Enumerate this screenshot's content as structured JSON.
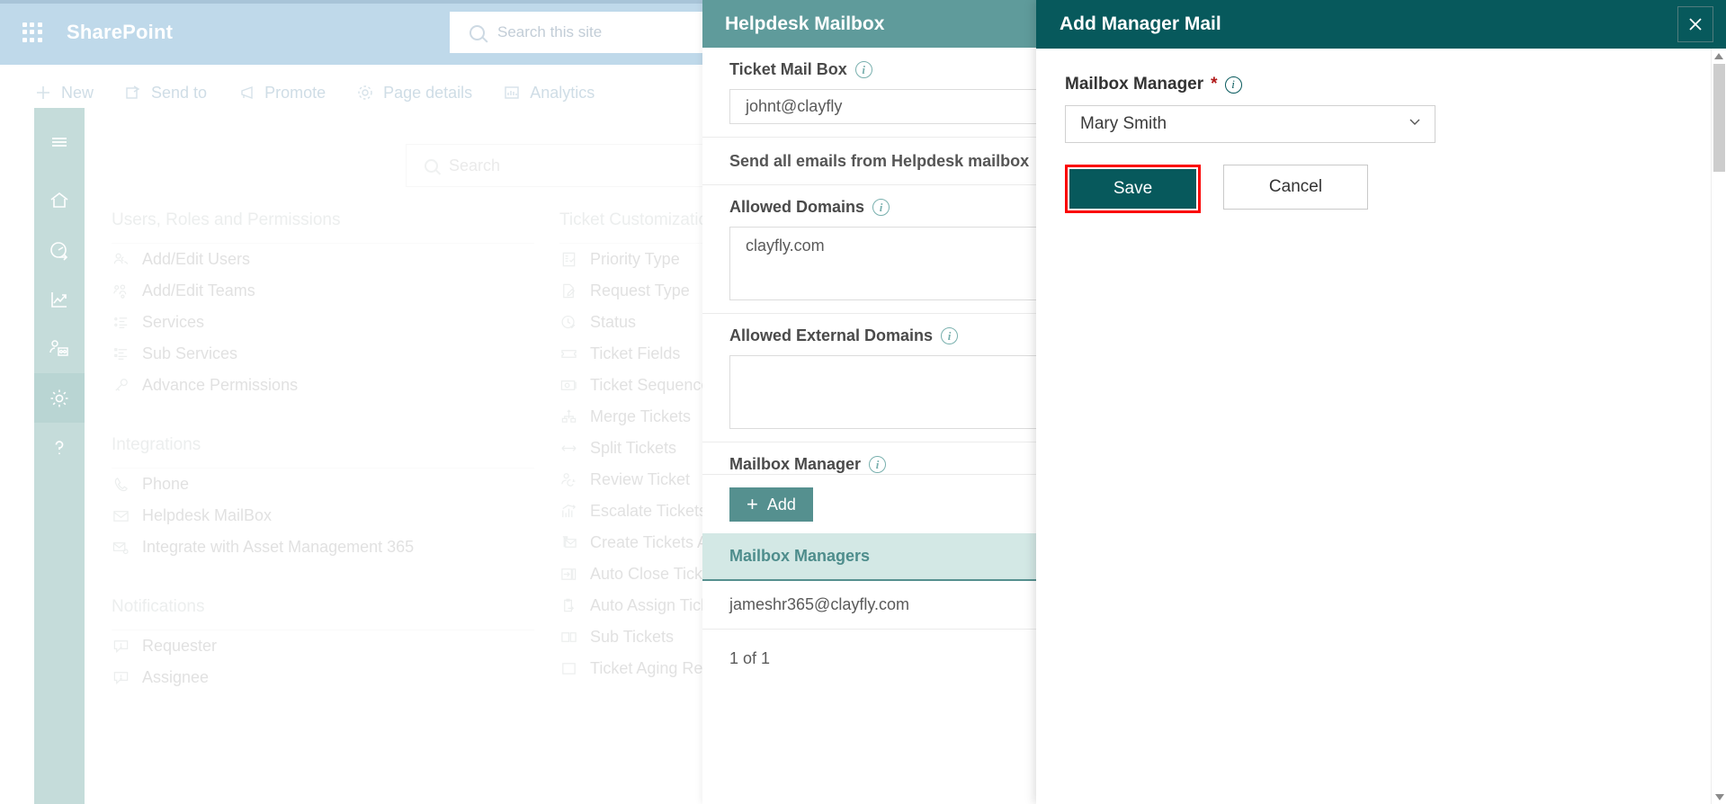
{
  "sharepoint": {
    "brand": "SharePoint",
    "waffle_icon": "app-launcher-icon",
    "search_placeholder": "Search this site",
    "search_icon": "search-icon",
    "commands": [
      {
        "label": "New",
        "icon": "plus-icon"
      },
      {
        "label": "Send to",
        "icon": "send-to-icon"
      },
      {
        "label": "Promote",
        "icon": "megaphone-icon"
      },
      {
        "label": "Page details",
        "icon": "gear-icon"
      },
      {
        "label": "Analytics",
        "icon": "analytics-icon"
      }
    ]
  },
  "left_rail": {
    "items": [
      {
        "name": "hamburger-icon",
        "active": false
      },
      {
        "name": "home-icon",
        "active": false
      },
      {
        "name": "dashboard-icon",
        "active": false
      },
      {
        "name": "reports-icon",
        "active": false
      },
      {
        "name": "agents-icon",
        "active": false
      },
      {
        "name": "settings-icon",
        "active": true
      },
      {
        "name": "help-icon",
        "active": false
      }
    ]
  },
  "settings_page": {
    "search_placeholder": "Search",
    "groups": [
      {
        "title": "Users, Roles and Permissions",
        "items": [
          {
            "label": "Add/Edit Users",
            "icon": "users-icon"
          },
          {
            "label": "Add/Edit Teams",
            "icon": "teams-icon"
          },
          {
            "label": "Services",
            "icon": "list-icon"
          },
          {
            "label": "Sub Services",
            "icon": "sub-list-icon"
          },
          {
            "label": "Advance Permissions",
            "icon": "key-icon"
          }
        ]
      },
      {
        "title": "Integrations",
        "items": [
          {
            "label": "Phone",
            "icon": "phone-icon"
          },
          {
            "label": "Helpdesk MailBox",
            "icon": "envelope-icon"
          },
          {
            "label": "Integrate with Asset Management 365",
            "icon": "envelope-gear-icon"
          }
        ]
      },
      {
        "title": "Notifications",
        "items": [
          {
            "label": "Requester",
            "icon": "comment-icon"
          },
          {
            "label": "Assignee",
            "icon": "comment-icon"
          }
        ]
      }
    ],
    "groups2": [
      {
        "title": "Ticket Customization",
        "items": [
          {
            "label": "Priority Type",
            "icon": "priority-icon"
          },
          {
            "label": "Request Type",
            "icon": "request-icon"
          },
          {
            "label": "Status",
            "icon": "clock-icon"
          },
          {
            "label": "Ticket Fields",
            "icon": "ticket-icon"
          },
          {
            "label": "Ticket Sequence",
            "icon": "sequence-icon"
          },
          {
            "label": "Merge Tickets",
            "icon": "merge-icon"
          },
          {
            "label": "Split Tickets",
            "icon": "split-icon"
          },
          {
            "label": "Review Ticket",
            "icon": "review-icon"
          },
          {
            "label": "Escalate Tickets",
            "icon": "escalate-icon"
          },
          {
            "label": "Create Tickets Automatically",
            "icon": "create-auto-icon"
          },
          {
            "label": "Auto Close Tickets",
            "icon": "auto-close-icon"
          },
          {
            "label": "Auto Assign Tickets",
            "icon": "auto-assign-icon"
          },
          {
            "label": "Sub Tickets",
            "icon": "sub-tickets-icon"
          },
          {
            "label": "Ticket Aging Reports",
            "icon": "aging-icon"
          }
        ]
      }
    ]
  },
  "helpdesk_panel": {
    "title": "Helpdesk Mailbox",
    "ticket_mailbox_label": "Ticket Mail Box",
    "ticket_mailbox_value": "johnt@clayfly",
    "send_all_label": "Send all emails from Helpdesk mailbox",
    "allowed_domains_label": "Allowed Domains",
    "allowed_domains_value": "clayfly.com",
    "allowed_external_label": "Allowed External Domains",
    "allowed_external_value": "",
    "mailbox_manager_label": "Mailbox Manager",
    "add_button": "Add",
    "table_header": "Mailbox Managers",
    "rows": [
      "jameshr365@clayfly.com"
    ],
    "count_text": "1 of 1",
    "info_icon": "info-icon"
  },
  "dialog": {
    "title": "Add Manager Mail",
    "close_icon": "close-icon",
    "field_label": "Mailbox Manager",
    "required_marker": "*",
    "info_icon": "info-icon",
    "select_value": "Mary Smith",
    "select_caret_icon": "chevron-down-icon",
    "save_label": "Save",
    "cancel_label": "Cancel",
    "highlight_color": "#fb0303",
    "header_color": "#07595c"
  }
}
